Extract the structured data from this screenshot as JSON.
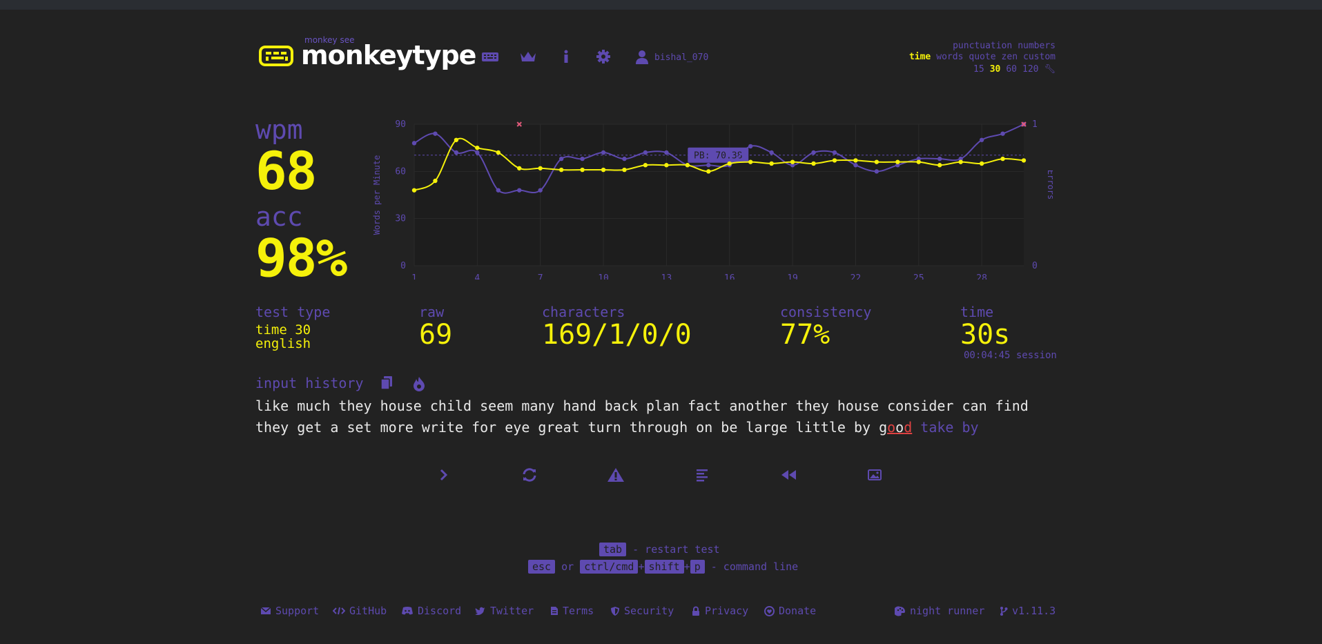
{
  "app": {
    "logo_sub": "monkey see",
    "logo_title": "monkeytype",
    "username": "bishal_070"
  },
  "nav": {
    "icons": [
      "keyboard-icon",
      "crown-icon",
      "info-icon",
      "gear-icon",
      "user-icon"
    ]
  },
  "modes": {
    "row1": [
      "punctuation",
      "numbers"
    ],
    "row2": [
      "time",
      "words",
      "quote",
      "zen",
      "custom"
    ],
    "row2_active": "time",
    "row3": [
      "15",
      "30",
      "60",
      "120"
    ],
    "row3_active": "30"
  },
  "result": {
    "wpm_label": "wpm",
    "wpm": "68",
    "acc_label": "acc",
    "acc": "98%"
  },
  "stats": {
    "test_type_label": "test type",
    "test_type_line1": "time 30",
    "test_type_line2": "english",
    "raw_label": "raw",
    "raw": "69",
    "characters_label": "characters",
    "characters": "169/1/0/0",
    "consistency_label": "consistency",
    "consistency": "77%",
    "time_label": "time",
    "time": "30s",
    "session": "00:04:45 session"
  },
  "chart_data": {
    "type": "line",
    "ylabel": "Words per Minute",
    "y2label": "Errors",
    "x": [
      1,
      2,
      3,
      4,
      5,
      6,
      7,
      8,
      9,
      10,
      11,
      12,
      13,
      14,
      15,
      16,
      17,
      18,
      19,
      20,
      21,
      22,
      23,
      24,
      25,
      26,
      27,
      28,
      29,
      30
    ],
    "xticks": [
      "1",
      "4",
      "7",
      "10",
      "13",
      "16",
      "19",
      "22",
      "25",
      "28"
    ],
    "yticks": [
      "0",
      "30",
      "60",
      "90"
    ],
    "y2ticks": [
      "0",
      "1"
    ],
    "ylim": [
      0,
      90
    ],
    "y2lim": [
      0,
      1
    ],
    "pb_label": "PB: 70.38",
    "pb_value": 70.38,
    "series": [
      {
        "color": "#f5f10a",
        "values": [
          48,
          54,
          80,
          75,
          72,
          62,
          62,
          61,
          61,
          61,
          61,
          64,
          64,
          64,
          60,
          65,
          66,
          65,
          66,
          65,
          67,
          67,
          66,
          66,
          66,
          64,
          66,
          65,
          68,
          67
        ]
      },
      {
        "color": "#5e4ab0",
        "values": [
          78,
          84,
          72,
          72,
          48,
          48,
          48,
          68,
          68,
          72,
          68,
          72,
          72,
          64,
          64,
          64,
          76,
          72,
          64,
          72,
          72,
          64,
          60,
          64,
          68,
          68,
          68,
          80,
          84,
          90
        ]
      }
    ],
    "errors": [
      {
        "x": 6,
        "value": 1
      },
      {
        "x": 30,
        "value": 1
      }
    ],
    "grid": true
  },
  "input_history": {
    "label": "input history",
    "line1": "like much they house child seem many hand back plan fact another they house consider can find",
    "line2_typed": "they get a set more write for eye great turn through on be large little by g",
    "line2_err_a": "o",
    "line2_ok": "o",
    "line2_err_b": "d",
    "line2_rest": " take by"
  },
  "actions": [
    "next-test",
    "restart",
    "report",
    "word-history",
    "replay",
    "screenshot"
  ],
  "hints": {
    "tab_key": "tab",
    "tab_text": "- restart test",
    "esc_key": "esc",
    "or": "or",
    "ctrl_key": "ctrl/cmd",
    "plus1": "+",
    "shift_key": "shift",
    "plus2": "+",
    "p_key": "p",
    "cmd_text": "- command line"
  },
  "footer": {
    "support": "Support",
    "github": "GitHub",
    "discord": "Discord",
    "twitter": "Twitter",
    "terms": "Terms",
    "security": "Security",
    "privacy": "Privacy",
    "donate": "Donate",
    "theme": "night runner",
    "version": "v1.11.3"
  }
}
